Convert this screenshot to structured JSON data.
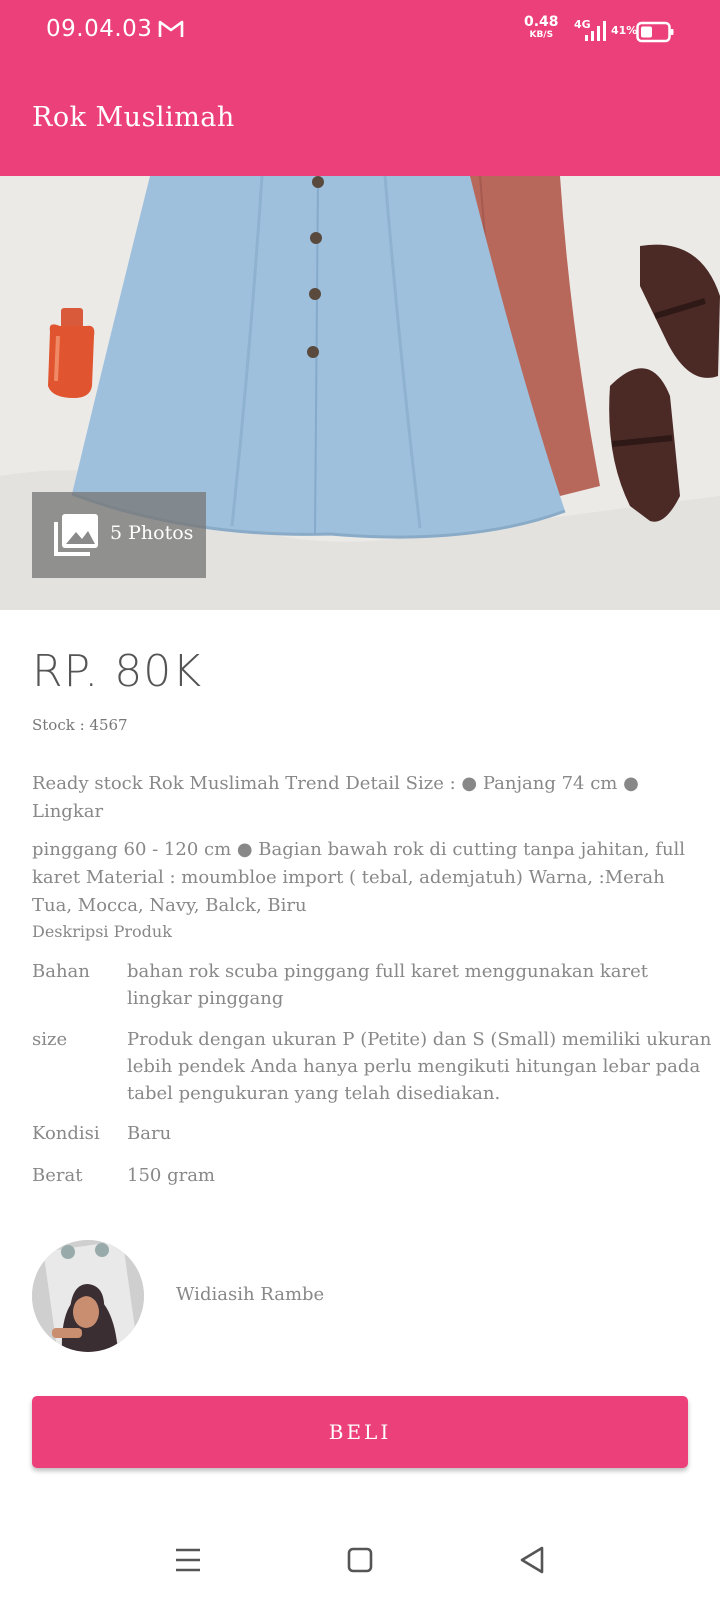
{
  "status_bar": {
    "time": "09.04.03",
    "net_speed": "0.48",
    "net_speed_unit": "KB/S",
    "network_type": "4G",
    "battery_percent": "41%"
  },
  "app_bar": {
    "title": "Rok Muslimah"
  },
  "hero": {
    "photos_label": "5 Photos"
  },
  "product": {
    "price": "RP. 80K",
    "stock": "Stock : 4567",
    "description_line1": "Ready stock Rok Muslimah Trend Detail Size : ● Panjang 74 cm ● Lingkar",
    "description_rest": "pinggang 60 - 120 cm ● Bagian bawah rok di cutting tanpa jahitan, full karet Material : moumbloe import ( tebal, ademjatuh) Warna, :Merah Tua, Mocca, Navy, Balck, Biru"
  },
  "details": {
    "heading": "Deskripsi Produk",
    "rows": [
      {
        "key": "Bahan",
        "value": "bahan rok scuba pinggang full karet menggunakan karet lingkar pinggang"
      },
      {
        "key": "size",
        "value": "Produk dengan ukuran P (Petite) dan S (Small) memiliki ukuran lebih pendek Anda hanya perlu mengikuti hitungan lebar pada tabel pengukuran yang telah disediakan."
      },
      {
        "key": "Kondisi",
        "value": "Baru"
      },
      {
        "key": "Berat",
        "value": "150 gram"
      }
    ]
  },
  "seller": {
    "name": "Widiasih Rambe"
  },
  "buy_button": {
    "label": "BELI"
  },
  "colors": {
    "accent": "#ec407a"
  },
  "icons": {
    "status": [
      "gmail-icon",
      "signal-icon",
      "battery-icon"
    ],
    "photos": "gallery-icon",
    "nav": [
      "menu-icon",
      "home-icon",
      "back-icon"
    ]
  }
}
